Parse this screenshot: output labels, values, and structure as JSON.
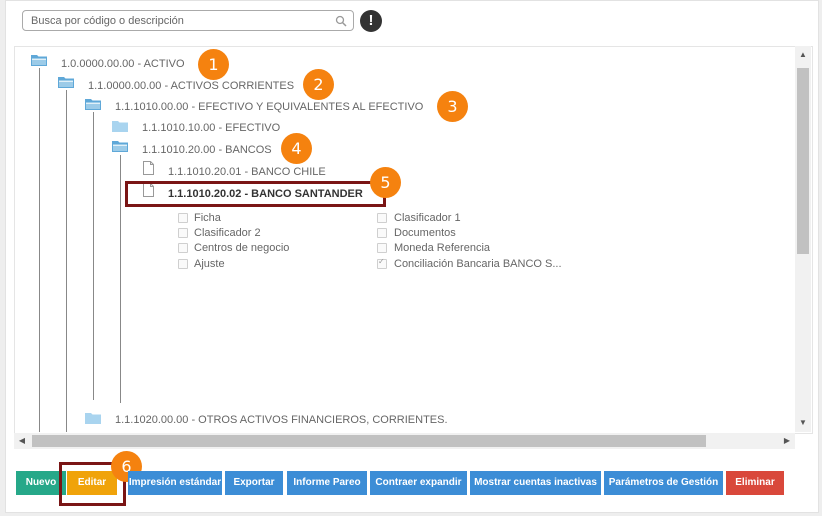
{
  "search": {
    "placeholder": "Busca por código o descripción"
  },
  "alert_icon": "!",
  "tree": {
    "nodes": [
      {
        "label": "1.0.0000.00.00 - ACTIVO"
      },
      {
        "label": "1.1.0000.00.00 - ACTIVOS CORRIENTES"
      },
      {
        "label": "1.1.1010.00.00 - EFECTIVO Y EQUIVALENTES AL EFECTIVO"
      },
      {
        "label": "1.1.1010.10.00 - EFECTIVO"
      },
      {
        "label": "1.1.1010.20.00 - BANCOS"
      },
      {
        "label": "1.1.1010.20.01 - BANCO CHILE"
      },
      {
        "label": "1.1.1010.20.02 - BANCO SANTANDER"
      },
      {
        "label": "1.1.1020.00.00 - OTROS ACTIVOS FINANCIEROS, CORRIENTES."
      }
    ],
    "options_left": [
      "Ficha",
      "Clasificador 2",
      "Centros de negocio",
      "Ajuste"
    ],
    "options_right": [
      "Clasificador 1",
      "Documentos",
      "Moneda Referencia",
      "Conciliación Bancaria BANCO S..."
    ]
  },
  "badges": [
    "1",
    "2",
    "3",
    "4",
    "5",
    "6"
  ],
  "buttons": {
    "nuevo": "Nuevo",
    "editar": "Editar",
    "impresion": "Impresión estándar",
    "exportar": "Exportar",
    "informe": "Informe Pareo",
    "contraer": "Contraer expandir",
    "mostrar": "Mostrar cuentas inactivas",
    "parametros": "Parámetros de Gestión",
    "eliminar": "Eliminar"
  },
  "colors": {
    "badge": "#f5820f",
    "highlight": "#7a1515",
    "nuevo": "#26a889",
    "editar": "#f0a30a",
    "primary": "#3c8dd6",
    "eliminar": "#d9483b"
  }
}
